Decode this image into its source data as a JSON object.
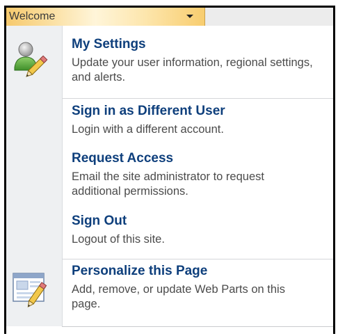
{
  "menu_button": {
    "label": "Welcome",
    "icon": "chevron-down-icon"
  },
  "items": [
    {
      "title": "My Settings",
      "description": "Update your user information, regional settings, and alerts.",
      "icon": "user-edit-icon"
    },
    {
      "title": "Sign in as Different User",
      "description": "Login with a different account."
    },
    {
      "title": "Request Access",
      "description": "Email the site administrator to request additional permissions."
    },
    {
      "title": "Sign Out",
      "description": "Logout of this site."
    },
    {
      "title": "Personalize this Page",
      "description": "Add, remove, or update Web Parts on this page.",
      "icon": "page-edit-icon"
    }
  ]
}
